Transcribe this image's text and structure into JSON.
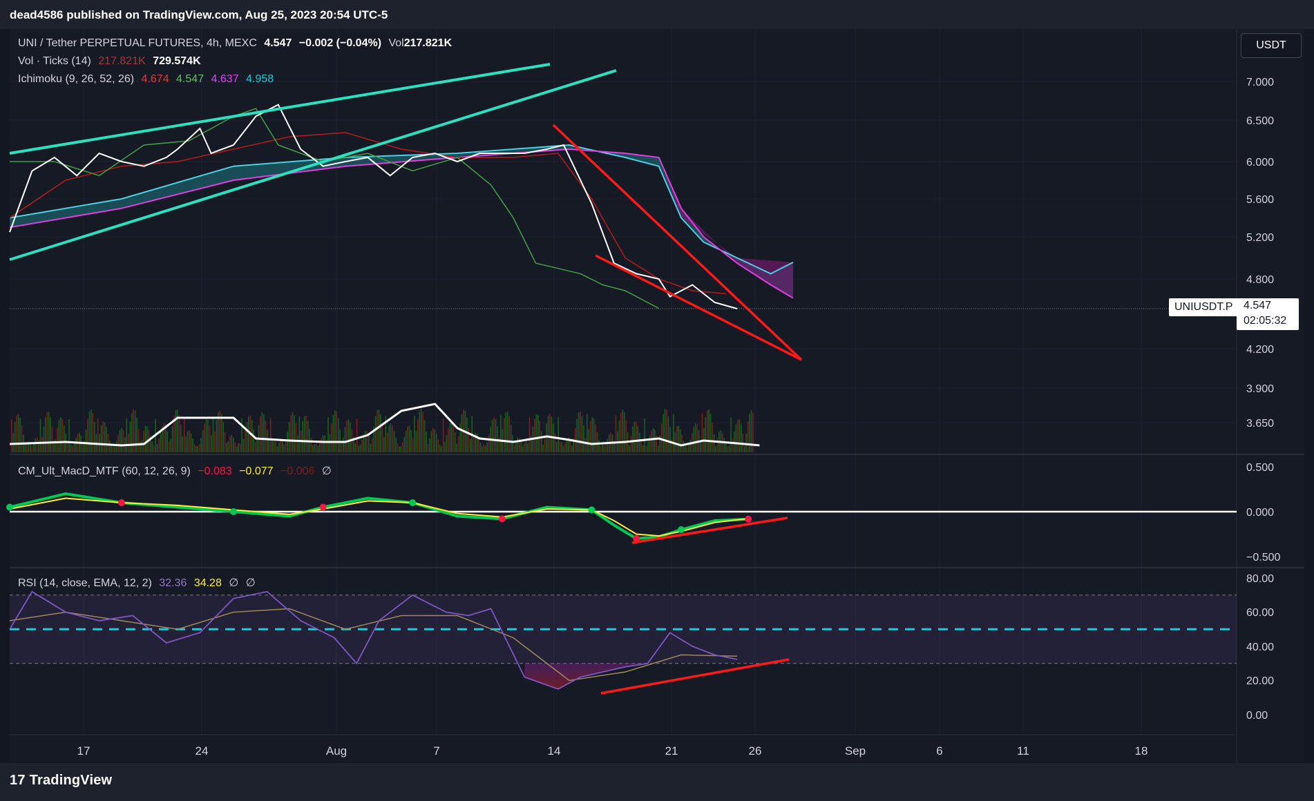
{
  "header": {
    "publisher_line": "dead4586 published on TradingView.com, Aug 25, 2023 20:54 UTC-5"
  },
  "footer": {
    "logo_mark": "17",
    "logo_text": "TradingView"
  },
  "currency_button": "USDT",
  "symbol_tag": "UNIUSDT.P",
  "last_price": {
    "price": "4.547",
    "countdown": "02:05:32"
  },
  "legends": {
    "main": {
      "symbol": "UNI / Tether PERPETUAL FUTURES, 4h, MEXC",
      "price": "4.547",
      "change": "−0.002 (−0.04%)",
      "vol_label": "Vol",
      "vol_value": "217.821K"
    },
    "vol_ticks": {
      "name": "Vol · Ticks (14)",
      "v1": "217.821K",
      "v2": "729.574K"
    },
    "ichimoku": {
      "name": "Ichimoku (9, 26, 52, 26)",
      "v1": "4.674",
      "v2": "4.547",
      "v3": "4.637",
      "v4": "4.958"
    },
    "macd": {
      "name": "CM_Ult_MacD_MTF (60, 12, 26, 9)",
      "v1": "−0.083",
      "v2": "−0.077",
      "v3": "−0.006",
      "v4": "∅"
    },
    "rsi": {
      "name": "RSI (14, close, EMA, 12, 2)",
      "v1": "32.36",
      "v2": "34.28",
      "v3": "∅",
      "v4": "∅"
    }
  },
  "colors": {
    "background": "#131722",
    "price_line": "#ffffff",
    "trend_cyan": "#2ce0c0",
    "trend_red": "#ff1a1a",
    "kumo_bull": "#1e8a93",
    "kumo_bear": "#6a1b6a",
    "span_b": "#e040e0",
    "span_a_cyan": "#4dd0e1",
    "kijun": "#b71c1c",
    "chikou": "#43a047",
    "rsi_line": "#7e57c2",
    "rsi_mid": "#26c6da",
    "vol_up": "#1b5e20",
    "vol_down": "#7f1d1d",
    "macd_up": "#00c853",
    "macd_dn": "#ff1744"
  },
  "chart_data": [
    {
      "type": "line",
      "pane": "price",
      "title": "UNI / Tether PERPETUAL FUTURES, 4h, MEXC",
      "x_ticks": [
        "17",
        "24",
        "Aug",
        "7",
        "14",
        "21",
        "26",
        "Sep",
        "6",
        "11",
        "18"
      ],
      "y_ticks": [
        "7.000",
        "6.500",
        "6.000",
        "5.600",
        "5.200",
        "4.800",
        "4.200",
        "3.900",
        "3.650"
      ],
      "last_price": 4.547,
      "series": [
        {
          "name": "Close",
          "x": [
            0,
            2,
            4,
            6,
            8,
            10,
            12,
            14,
            15,
            17,
            18,
            20,
            22,
            24,
            26,
            28,
            30,
            32,
            34,
            36,
            38,
            40,
            42,
            44,
            46,
            48,
            49.5,
            52,
            54,
            56,
            58,
            59,
            61,
            63,
            65
          ],
          "y": [
            5.25,
            5.9,
            6.05,
            5.85,
            6.1,
            6.0,
            5.95,
            6.05,
            6.15,
            6.4,
            6.1,
            6.2,
            6.55,
            6.7,
            6.15,
            5.95,
            6.0,
            6.05,
            5.85,
            6.05,
            6.1,
            6.0,
            6.1,
            6.1,
            6.1,
            6.15,
            6.2,
            5.55,
            4.95,
            4.85,
            4.8,
            4.65,
            4.75,
            4.6,
            4.547
          ]
        },
        {
          "name": "Ichimoku Conversion",
          "x": [
            0,
            5,
            10,
            15,
            20,
            25,
            30,
            35,
            40,
            45,
            49,
            52,
            55,
            58,
            61,
            64
          ],
          "y": [
            5.4,
            5.8,
            5.95,
            6.0,
            6.15,
            6.3,
            6.35,
            6.15,
            6.05,
            6.05,
            6.1,
            5.6,
            5.0,
            4.8,
            4.7,
            4.674
          ]
        },
        {
          "name": "Ichimoku Lagging",
          "x": [
            0,
            4,
            8,
            12,
            16,
            20,
            22,
            24,
            28,
            32,
            36,
            40,
            43,
            45,
            47,
            49,
            51,
            53,
            55,
            57,
            58
          ],
          "y": [
            6.0,
            6.0,
            5.85,
            6.2,
            6.25,
            6.55,
            6.65,
            6.2,
            6.0,
            6.1,
            5.9,
            6.05,
            5.75,
            5.4,
            4.95,
            4.9,
            4.85,
            4.75,
            4.7,
            4.6,
            4.55
          ]
        },
        {
          "name": "Ichimoku Span A",
          "x": [
            0,
            10,
            20,
            30,
            40,
            50,
            55,
            58,
            60,
            62,
            65,
            68,
            70
          ],
          "y": [
            5.4,
            5.6,
            5.95,
            6.05,
            6.1,
            6.2,
            6.05,
            5.95,
            5.4,
            5.15,
            5.0,
            4.85,
            4.958
          ]
        },
        {
          "name": "Ichimoku Span B",
          "x": [
            0,
            10,
            20,
            30,
            40,
            50,
            55,
            58,
            60,
            62,
            65,
            68,
            70
          ],
          "y": [
            5.3,
            5.5,
            5.8,
            5.95,
            6.05,
            6.15,
            6.1,
            6.05,
            5.5,
            5.2,
            4.95,
            4.75,
            4.637
          ]
        }
      ]
    },
    {
      "type": "bar",
      "pane": "volume",
      "series": [
        {
          "name": "Vol · Ticks (14)",
          "values": [
            217.821,
            729.574
          ]
        }
      ]
    },
    {
      "type": "line",
      "pane": "macd",
      "title": "CM_Ult_MacD_MTF (60, 12, 26, 9)",
      "y_ticks": [
        "0.500",
        "0.000",
        "−0.500"
      ],
      "ylim": [
        -0.55,
        0.55
      ],
      "series": [
        {
          "name": "MACD",
          "x": [
            0,
            5,
            10,
            15,
            20,
            25,
            28,
            32,
            36,
            40,
            44,
            48,
            52,
            54,
            56,
            58,
            60,
            63,
            66
          ],
          "y": [
            0.05,
            0.2,
            0.1,
            0.05,
            0.0,
            -0.05,
            0.05,
            0.15,
            0.1,
            -0.05,
            -0.08,
            0.05,
            0.02,
            -0.15,
            -0.3,
            -0.28,
            -0.2,
            -0.1,
            -0.083
          ]
        },
        {
          "name": "Signal",
          "x": [
            0,
            5,
            10,
            15,
            20,
            25,
            28,
            32,
            36,
            40,
            44,
            48,
            52,
            54,
            56,
            58,
            60,
            63,
            66
          ],
          "y": [
            0.03,
            0.15,
            0.1,
            0.07,
            0.02,
            -0.03,
            0.03,
            0.12,
            0.1,
            -0.02,
            -0.06,
            0.03,
            0.02,
            -0.1,
            -0.25,
            -0.27,
            -0.22,
            -0.12,
            -0.077
          ]
        }
      ]
    },
    {
      "type": "line",
      "pane": "rsi",
      "title": "RSI (14, close, EMA, 12, 2)",
      "y_ticks": [
        "80.00",
        "60.00",
        "40.00",
        "20.00",
        "0.00"
      ],
      "ylim": [
        -5,
        85
      ],
      "series": [
        {
          "name": "RSI",
          "x": [
            0,
            2,
            5,
            8,
            11,
            14,
            17,
            20,
            23,
            26,
            29,
            31,
            33,
            36,
            39,
            41,
            43,
            46,
            49,
            51,
            53,
            55,
            57,
            59,
            61,
            63,
            65
          ],
          "y": [
            50,
            72,
            60,
            55,
            58,
            42,
            48,
            68,
            72,
            55,
            45,
            30,
            55,
            70,
            60,
            58,
            62,
            22,
            15,
            22,
            25,
            28,
            30,
            48,
            40,
            35,
            32.36
          ]
        },
        {
          "name": "RSI-based MA",
          "x": [
            0,
            5,
            10,
            15,
            20,
            25,
            30,
            35,
            40,
            45,
            50,
            55,
            60,
            65
          ],
          "y": [
            55,
            60,
            55,
            50,
            60,
            62,
            50,
            58,
            58,
            45,
            20,
            25,
            35,
            34.28
          ]
        }
      ]
    }
  ]
}
